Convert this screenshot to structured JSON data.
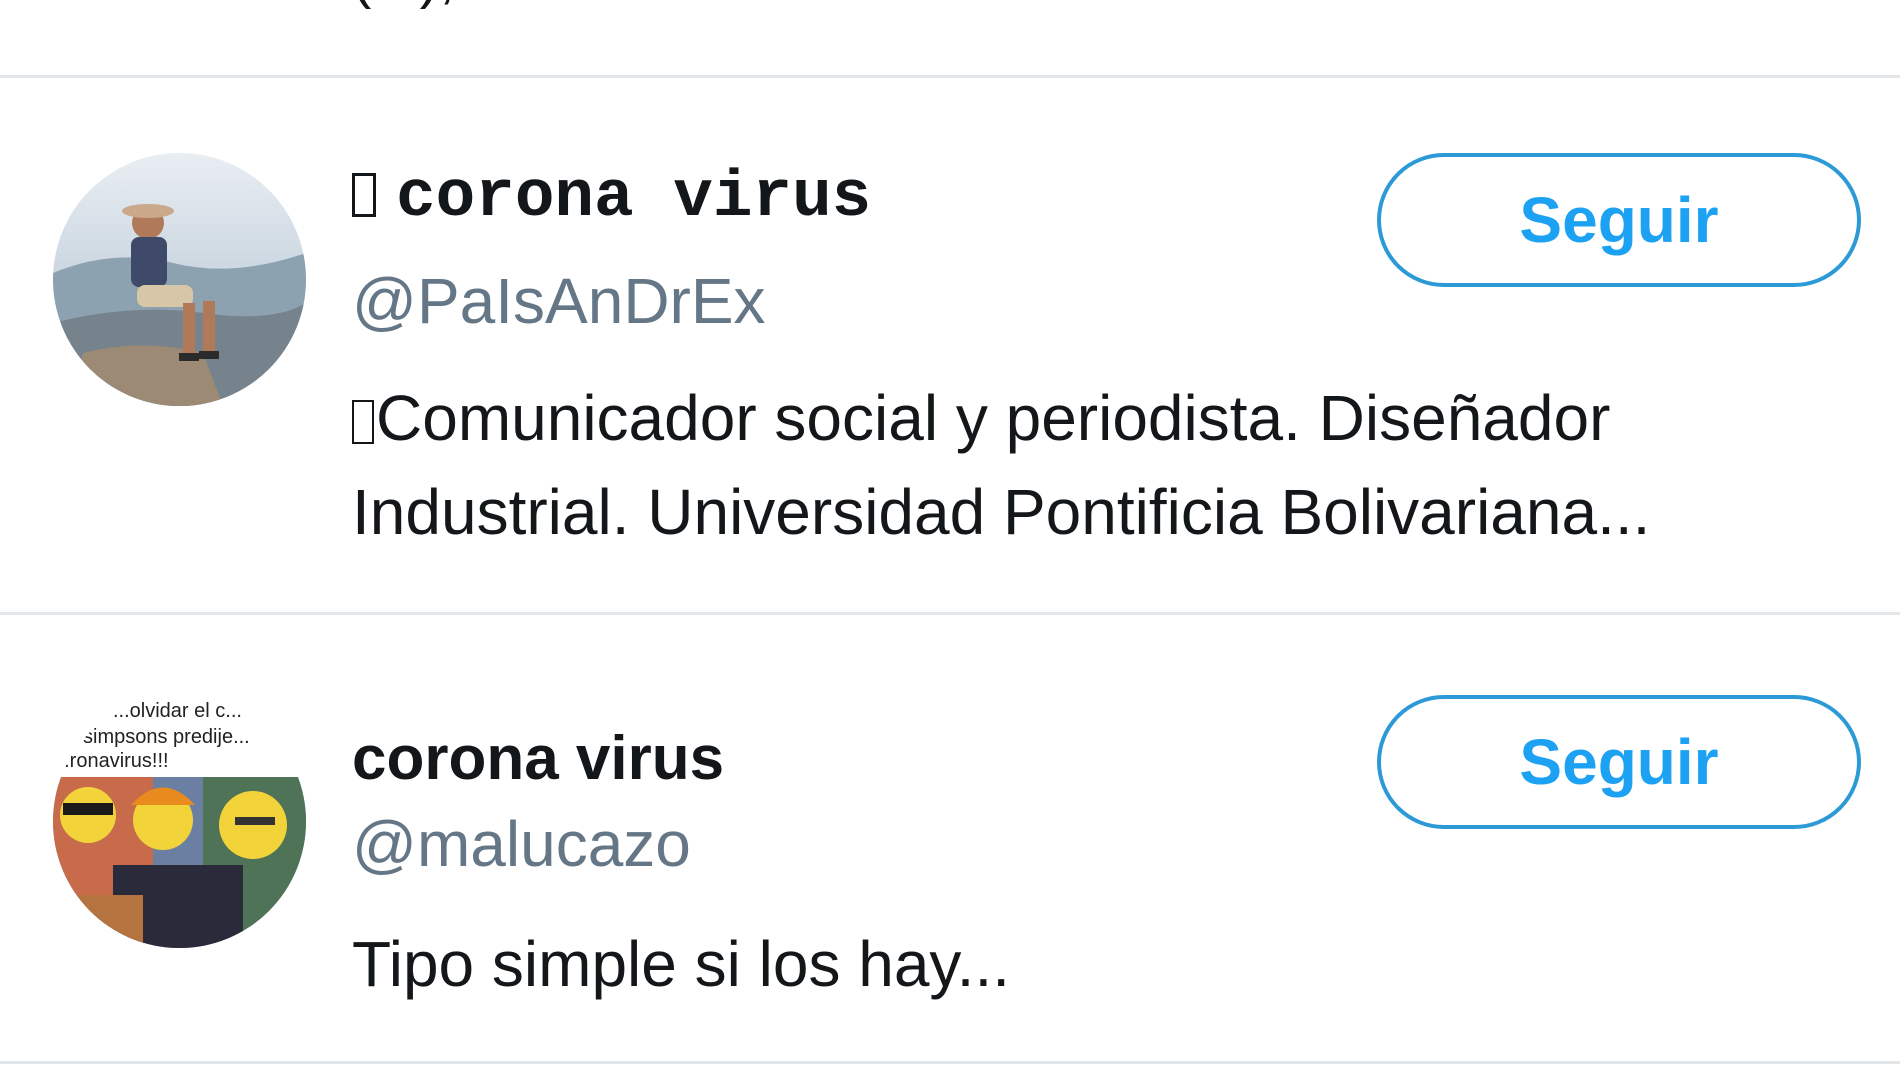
{
  "header_fragment": {
    "text": "(...), ... ... ... ... ..."
  },
  "users": [
    {
      "display_name": "corona virus",
      "name_prefix_glyph": "missing-glyph",
      "handle": "@PaIsAnDrEx",
      "bio": "Comunicador social y periodista. Diseñador Industrial. Universidad Pontificia Bolivariana...",
      "follow_label": "Seguir"
    },
    {
      "display_name": "corona virus",
      "handle": "@malucazo",
      "bio": "Tipo simple si los hay...",
      "follow_label": "Seguir",
      "avatar_caption": [
        "...olvidar el c...",
        "simpsons predije...",
        "...ronavirus!!!"
      ]
    }
  ],
  "colors": {
    "accent": "#1da1f2",
    "button_border": "#2d9ad8",
    "handle_gray": "#657786",
    "divider": "#e3e6e8",
    "text": "#14171a"
  }
}
